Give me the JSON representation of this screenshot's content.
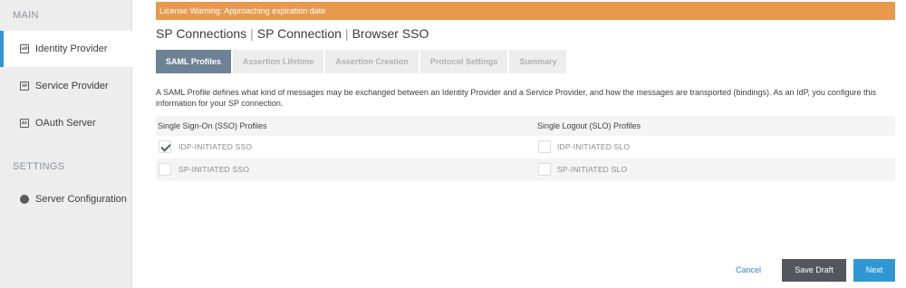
{
  "sidebar": {
    "main_label": "MAIN",
    "settings_label": "SETTINGS",
    "items": [
      {
        "label": "Identity Provider",
        "icon": "idp-icon",
        "active": true
      },
      {
        "label": "Service Provider",
        "icon": "sp-icon",
        "active": false
      },
      {
        "label": "OAuth Server",
        "icon": "as-icon",
        "active": false
      }
    ],
    "settings_items": [
      {
        "label": "Server Configuration",
        "icon": "server-config-icon"
      }
    ]
  },
  "warning": {
    "text": "License Warning: Approaching expiration date"
  },
  "breadcrumb": {
    "part1": "SP Connections",
    "part2": "SP Connection",
    "part3": "Browser SSO",
    "separator": "|"
  },
  "tabs": [
    {
      "label": "SAML Profiles",
      "active": true
    },
    {
      "label": "Assertion Lifetime",
      "active": false
    },
    {
      "label": "Assertion Creation",
      "active": false
    },
    {
      "label": "Protocol Settings",
      "active": false
    },
    {
      "label": "Summary",
      "active": false
    }
  ],
  "description": "A SAML Profile defines what kind of messages may be exchanged between an Identity Provider and a Service Provider, and how the messages are transported (bindings). As an IdP, you configure this information for your SP connection.",
  "profiles": {
    "sso_header": "Single Sign-On (SSO) Profiles",
    "slo_header": "Single Logout (SLO) Profiles",
    "rows": [
      {
        "sso_label": "IDP-INITIATED SSO",
        "sso_checked": true,
        "slo_label": "IDP-INITIATED SLO",
        "slo_checked": false
      },
      {
        "sso_label": "SP-INITIATED SSO",
        "sso_checked": false,
        "slo_label": "SP-INITIATED SLO",
        "slo_checked": false
      }
    ]
  },
  "footer": {
    "cancel_label": "Cancel",
    "save_draft_label": "Save Draft",
    "next_label": "Next"
  },
  "colors": {
    "warning_bg": "#e79a4d",
    "active_tab_bg": "#6e8295",
    "accent_blue": "#2f98d4",
    "save_draft_bg": "#53575b"
  }
}
